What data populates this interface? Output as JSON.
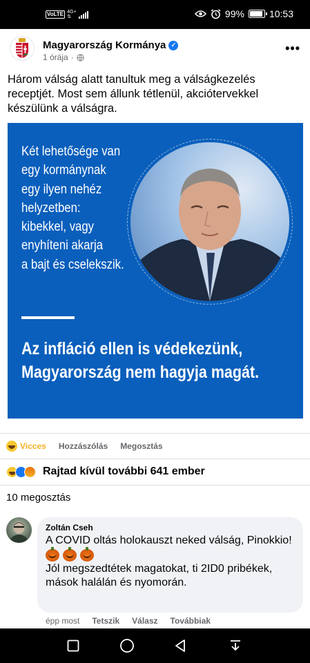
{
  "status_bar": {
    "volte": "VoLTE",
    "network": "4G+",
    "battery": "99%",
    "battery_level": 0.99,
    "time": "10:53"
  },
  "post": {
    "page_name": "Magyarország Kormánya",
    "time_ago": "1 órája",
    "separator": "·",
    "text": "Három válság alatt tanultuk meg a válságkezelés receptjét. Most sem állunk tétlenül, akciótervekkel készülünk a válságra.",
    "image": {
      "small_text": "Két lehetősége van\negy kormánynak\negy ilyen nehéz\nhelyzetben:\nkibekkel, vagy\nenyhíteni akarja\na bajt és cselekszik.",
      "big_text": "Az infláció ellen is védekezünk,\nMagyarország nem hagyja magát.",
      "bg_color": "#0a5fbc"
    }
  },
  "reaction_bar": {
    "reaction_label": "Vicces",
    "comment_label": "Hozzászólás",
    "share_label": "Megosztás"
  },
  "reactions_summary": "Rajtad kívül további 641 ember",
  "shares_count": "10 megosztás",
  "comment": {
    "author": "Zoltán Cseh",
    "line1": "A COVID oltás holokauszt neked válság, Pinokkio!",
    "line2": "Jól megszedtétek magatokat, ti 2ID0 pribékek, mások halálán és nyomorán.",
    "time": "épp most",
    "like_label": "Tetszik",
    "reply_label": "Válasz",
    "more_label": "Továbbiak"
  }
}
